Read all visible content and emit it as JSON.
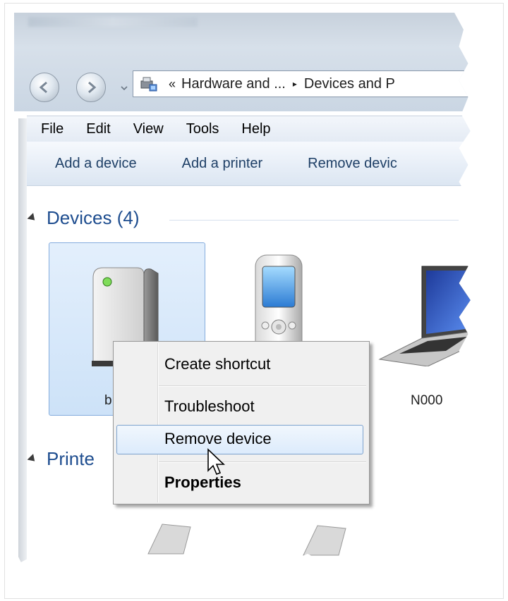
{
  "address_bar": {
    "history_glyph": "«",
    "crumb_1": "Hardware and ...",
    "crumb_chevron": "▸",
    "crumb_2": "Devices and P"
  },
  "menubar": {
    "items": [
      {
        "label": "File"
      },
      {
        "label": "Edit"
      },
      {
        "label": "View"
      },
      {
        "label": "Tools"
      },
      {
        "label": "Help"
      }
    ]
  },
  "toolbar": {
    "add_device": "Add a device",
    "add_printer": "Add a printer",
    "remove_device": "Remove devic"
  },
  "groups": {
    "devices": "Devices (4)",
    "printers": "Printe"
  },
  "devices": [
    {
      "label": "b",
      "icon": "network-device-icon"
    },
    {
      "label": "",
      "icon": "mobile-phone-icon"
    },
    {
      "label": "N000",
      "icon": "laptop-icon"
    }
  ],
  "context_menu": {
    "create_shortcut": "Create shortcut",
    "troubleshoot": "Troubleshoot",
    "remove_device": "Remove device",
    "properties": "Properties"
  },
  "colors": {
    "group_header": "#1e4d8f",
    "selection_fill": "#cde2f8",
    "selection_border": "#84acdd",
    "toolbar_text": "#1e3f66"
  }
}
